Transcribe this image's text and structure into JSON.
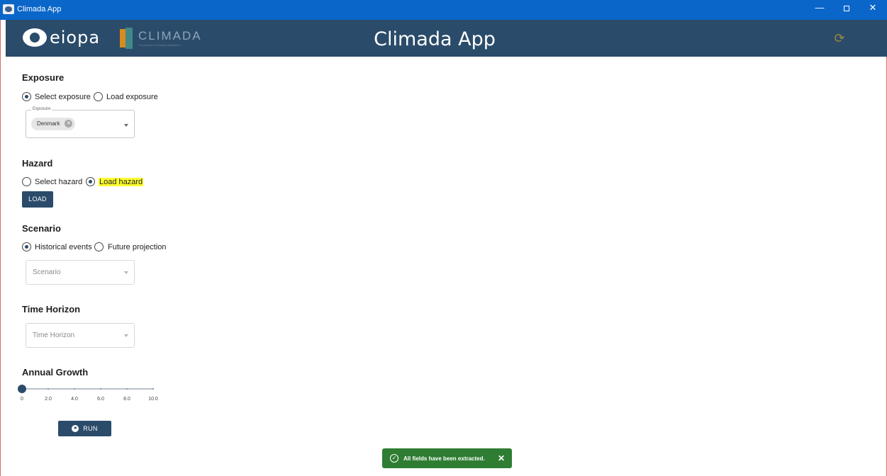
{
  "window": {
    "title": "Climada App",
    "min_glyph": "—",
    "close_glyph": "✕"
  },
  "header": {
    "logo_eiopa": "eiopa",
    "logo_climada": "CLIMADA",
    "logo_climada_tagline": "Economics of Climate Adaptation",
    "title": "Climada App",
    "refresh_icon": "refresh-icon"
  },
  "exposure": {
    "heading": "Exposure",
    "options": [
      "Select exposure",
      "Load exposure"
    ],
    "selected": "Select exposure",
    "field_label": "Exposure",
    "chip": "Denmark"
  },
  "hazard": {
    "heading": "Hazard",
    "options": [
      "Select hazard",
      "Load hazard"
    ],
    "selected": "Load hazard",
    "load_button": "LOAD"
  },
  "scenario": {
    "heading": "Scenario",
    "options": [
      "Historical events",
      "Future projection"
    ],
    "selected": "Historical events",
    "placeholder": "Scenario"
  },
  "time_horizon": {
    "heading": "Time Horizon",
    "placeholder": "Time Horizon"
  },
  "annual_growth": {
    "heading": "Annual Growth",
    "value": 0,
    "min": 0,
    "max": 10,
    "ticks": [
      "0",
      "2.0",
      "4.0",
      "6.0",
      "8.0",
      "10.0"
    ]
  },
  "run_button": "RUN",
  "snackbar": {
    "message": "All fields have been extracted.",
    "close": "✕"
  },
  "colors": {
    "primary": "#2b4b6a",
    "success": "#2e7d32",
    "highlight": "#ffff2e",
    "titlebar": "#0a66c9"
  }
}
